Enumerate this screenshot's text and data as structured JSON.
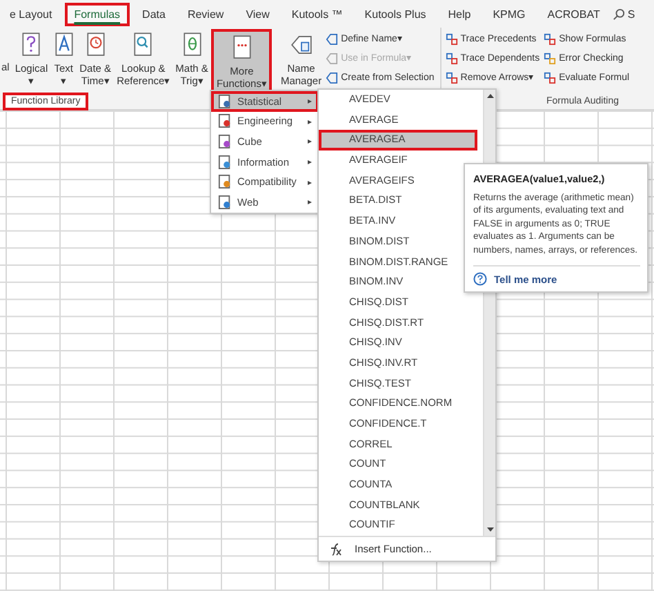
{
  "tabs": [
    {
      "label": "e Layout",
      "selected": false,
      "highlighted": false
    },
    {
      "label": "Formulas",
      "selected": true,
      "highlighted": true
    },
    {
      "label": "Data",
      "selected": false,
      "highlighted": false
    },
    {
      "label": "Review",
      "selected": false,
      "highlighted": false
    },
    {
      "label": "View",
      "selected": false,
      "highlighted": false
    },
    {
      "label": "Kutools ™",
      "selected": false,
      "highlighted": false
    },
    {
      "label": "Kutools Plus",
      "selected": false,
      "highlighted": false
    },
    {
      "label": "Help",
      "selected": false,
      "highlighted": false
    },
    {
      "label": "KPMG",
      "selected": false,
      "highlighted": false
    },
    {
      "label": "ACROBAT",
      "selected": false,
      "highlighted": false
    }
  ],
  "search": {
    "label": "S"
  },
  "function_library": {
    "label": "Function Library",
    "highlighted": true,
    "buttons": [
      {
        "lines": [
          "al"
        ],
        "highlighted": false,
        "pressed": false
      },
      {
        "lines": [
          "Logical"
        ],
        "dropdown": "▾",
        "highlighted": false,
        "pressed": false
      },
      {
        "lines": [
          "Text"
        ],
        "dropdown": "▾",
        "highlighted": false,
        "pressed": false
      },
      {
        "lines": [
          "Date &",
          "Time"
        ],
        "dropdown": "▾",
        "highlighted": false,
        "pressed": false
      },
      {
        "lines": [
          "Lookup &",
          "Reference"
        ],
        "dropdown": "▾",
        "highlighted": false,
        "pressed": false
      },
      {
        "lines": [
          "Math &",
          "Trig"
        ],
        "dropdown": "▾",
        "highlighted": false,
        "pressed": false
      },
      {
        "lines": [
          "More",
          "Functions"
        ],
        "dropdown": "▾",
        "highlighted": true,
        "pressed": true
      }
    ]
  },
  "defined_names": {
    "name_manager": [
      "Name",
      "Manager"
    ],
    "items": [
      {
        "label": "Define Name",
        "dropdown": "▾",
        "disabled": false
      },
      {
        "label": "Use in Formula",
        "dropdown": "▾",
        "disabled": true
      },
      {
        "label": "Create from Selection",
        "disabled": false
      }
    ]
  },
  "formula_auditing": {
    "label": "Formula Auditing",
    "columns": [
      [
        {
          "label": "Trace Precedents"
        },
        {
          "label": "Trace Dependents"
        },
        {
          "label": "Remove Arrows",
          "dropdown": "▾"
        }
      ],
      [
        {
          "label": "Show Formulas"
        },
        {
          "label": "Error Checking"
        },
        {
          "label": "Evaluate Formul"
        }
      ]
    ]
  },
  "category_menu": [
    {
      "label": "Statistical",
      "selected": true,
      "highlighted": true,
      "arrow": "▸"
    },
    {
      "label": "Engineering",
      "selected": false,
      "highlighted": false,
      "arrow": "▸"
    },
    {
      "label": "Cube",
      "selected": false,
      "highlighted": false,
      "arrow": "▸"
    },
    {
      "label": "Information",
      "selected": false,
      "highlighted": false,
      "arrow": "▸"
    },
    {
      "label": "Compatibility",
      "selected": false,
      "highlighted": false,
      "arrow": "▸"
    },
    {
      "label": "Web",
      "selected": false,
      "highlighted": false,
      "arrow": "▸"
    }
  ],
  "function_menu": {
    "items": [
      {
        "label": "AVEDEV",
        "selected": false
      },
      {
        "label": "AVERAGE",
        "selected": false
      },
      {
        "label": "AVERAGEA",
        "selected": true
      },
      {
        "label": "AVERAGEIF",
        "selected": false
      },
      {
        "label": "AVERAGEIFS",
        "selected": false
      },
      {
        "label": "BETA.DIST",
        "selected": false
      },
      {
        "label": "BETA.INV",
        "selected": false
      },
      {
        "label": "BINOM.DIST",
        "selected": false
      },
      {
        "label": "BINOM.DIST.RANGE",
        "selected": false
      },
      {
        "label": "BINOM.INV",
        "selected": false
      },
      {
        "label": "CHISQ.DIST",
        "selected": false
      },
      {
        "label": "CHISQ.DIST.RT",
        "selected": false
      },
      {
        "label": "CHISQ.INV",
        "selected": false
      },
      {
        "label": "CHISQ.INV.RT",
        "selected": false
      },
      {
        "label": "CHISQ.TEST",
        "selected": false
      },
      {
        "label": "CONFIDENCE.NORM",
        "selected": false
      },
      {
        "label": "CONFIDENCE.T",
        "selected": false
      },
      {
        "label": "CORREL",
        "selected": false
      },
      {
        "label": "COUNT",
        "selected": false
      },
      {
        "label": "COUNTA",
        "selected": false
      },
      {
        "label": "COUNTBLANK",
        "selected": false
      },
      {
        "label": "COUNTIF",
        "selected": false
      }
    ],
    "insert_function": "Insert Function..."
  },
  "tooltip": {
    "title": "AVERAGEA(value1,value2,)",
    "description": "Returns the average (arithmetic mean) of its arguments, evaluating text and FALSE in arguments as 0; TRUE evaluates as 1. Arguments can be numbers, names, arrays, or references.",
    "link": "Tell me more"
  }
}
